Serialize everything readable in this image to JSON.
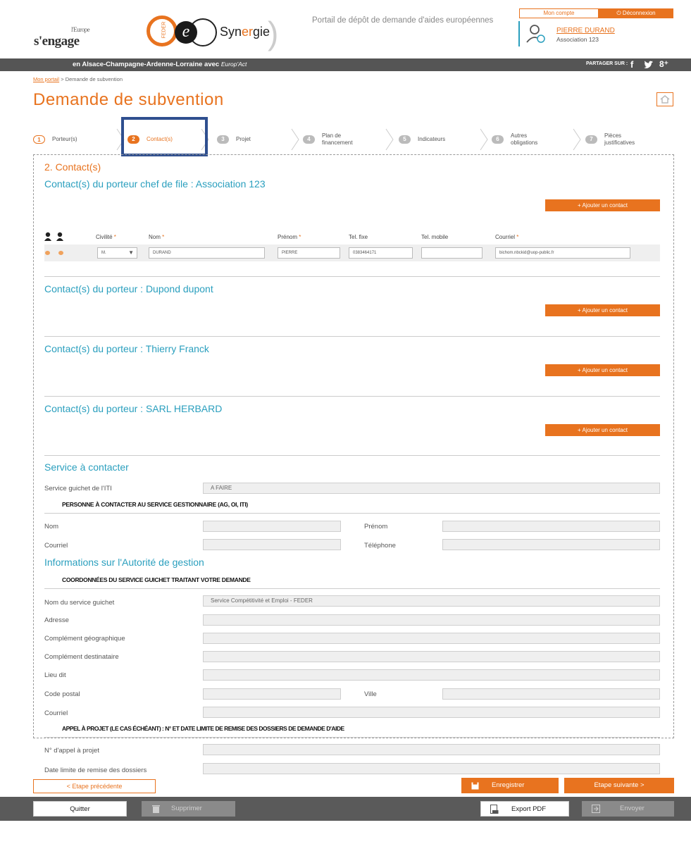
{
  "header": {
    "europe_small": "l'Europe",
    "europe_logo": "s'engage",
    "synergie_word": "Syn",
    "synergie_word_accent": "er",
    "synergie_word_end": "gie",
    "synergie_ring_text": "FEDER",
    "portal_title": "Portail de dépôt de demande d'aides européennes",
    "account_label": "Mon compte",
    "logout_label": "Déconnexion",
    "user_name": "PIERRE DURAND",
    "user_assoc": "Association 123"
  },
  "topbar": {
    "tagline": "en Alsace-Champagne-Ardenne-Lorraine avec",
    "tagline_brand": "Europ'Act",
    "share_label": "PARTAGER SUR :"
  },
  "breadcrumb": {
    "home": "Mon portail",
    "separator": ">",
    "current": "Demande de subvention"
  },
  "page_title": "Demande de subvention",
  "stepper": [
    {
      "num": "1",
      "label": "Porteur(s)",
      "state": "done"
    },
    {
      "num": "2",
      "label": "Contact(s)",
      "state": "active"
    },
    {
      "num": "3",
      "label": "Projet",
      "state": "todo"
    },
    {
      "num": "4",
      "label": "Plan de financement",
      "state": "todo"
    },
    {
      "num": "5",
      "label": "Indicateurs",
      "state": "todo"
    },
    {
      "num": "6",
      "label": "Autres obligations",
      "state": "todo"
    },
    {
      "num": "7",
      "label": "Pièces justificatives",
      "state": "todo"
    }
  ],
  "section_title": "2. Contact(s)",
  "chef_de_file": {
    "title": "Contact(s) du porteur chef de file : Association 123",
    "add_label": "+ Ajouter un contact",
    "columns": {
      "civilite": "Civilité",
      "nom": "Nom",
      "prenom": "Prénom",
      "tel_fixe": "Tel. fixe",
      "tel_mobile": "Tel. mobile",
      "courriel": "Courriel",
      "required_mark": "*"
    },
    "row": {
      "civilite": "M.",
      "nom": "DURAND",
      "prenom": "PIERRE",
      "tel_fixe": "0383464171",
      "tel_mobile": "",
      "courriel": "bichom.nbckid@uop-public.fr"
    }
  },
  "porteurs": [
    {
      "title": "Contact(s) du porteur : Dupond dupont",
      "add_label": "+ Ajouter un contact"
    },
    {
      "title": "Contact(s) du porteur : Thierry Franck",
      "add_label": "+ Ajouter un contact"
    },
    {
      "title": "Contact(s) du porteur : SARL HERBARD",
      "add_label": "+ Ajouter un contact"
    }
  ],
  "service": {
    "title": "Service à contacter",
    "guichet_label": "Service guichet de l'ITI",
    "guichet_value": "A FAIRE",
    "gest_title": "PERSONNE À CONTACTER AU SERVICE GESTIONNAIRE (AG, OI, ITI)",
    "nom_label": "Nom",
    "prenom_label": "Prénom",
    "courriel_label": "Courriel",
    "telephone_label": "Téléphone"
  },
  "autorite": {
    "title": "Informations sur l'Autorité de gestion",
    "coord_title": "COORDONNÉES DU SERVICE GUICHET TRAITANT VOTRE DEMANDE",
    "nom_service_label": "Nom du service guichet",
    "nom_service_value": "Service Compétitivité et Emploi - FEDER",
    "adresse_label": "Adresse",
    "comp_geo_label": "Complément géographique",
    "comp_dest_label": "Complément destinataire",
    "lieu_dit_label": "Lieu dit",
    "code_postal_label": "Code postal",
    "ville_label": "Ville",
    "courriel_label": "Courriel",
    "appel_title": "APPEL À PROJET (LE CAS ÉCHÉANT) : N° ET DATE LIMITE DE REMISE DES DOSSIERS DE DEMANDE D'AIDE",
    "num_appel_label": "N° d'appel à projet",
    "date_limite_label": "Date limite de remise des dossiers"
  },
  "footer": {
    "prev_label": "< Etape précédente",
    "save_label": "Enregistrer",
    "next_label": "Etape suivante >"
  },
  "bottombar": {
    "quit_label": "Quitter",
    "delete_label": "Supprimer",
    "export_label": "Export PDF",
    "send_label": "Envoyer"
  },
  "colors": {
    "accent": "#e8731f",
    "secondary": "#2a9fbe",
    "bar": "#555555",
    "highlight": "#2f4f8f"
  }
}
